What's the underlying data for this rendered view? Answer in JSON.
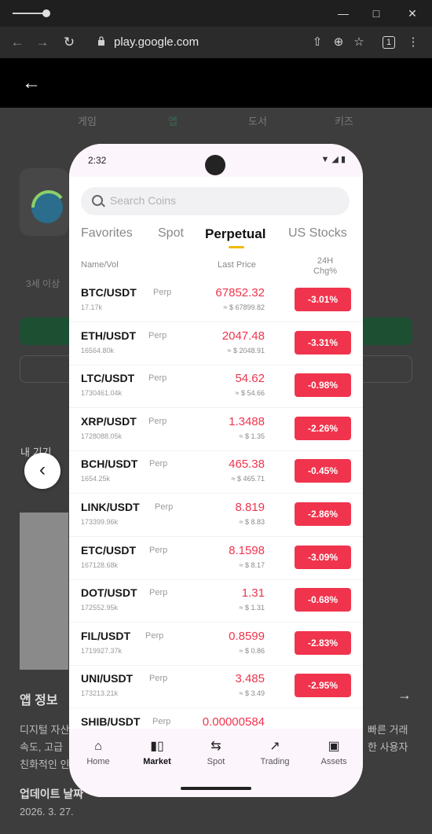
{
  "browser": {
    "url": "play.google.com",
    "tab_count": "1"
  },
  "store": {
    "categories": [
      "게임",
      "앱",
      "도서",
      "키즈"
    ],
    "age_label": "3세 이상",
    "device_label": "내 기기",
    "section_title": "앱 정보",
    "para_left": "디지털 자산",
    "para_left2": "속도, 고급 ",
    "para_left3": "친화적인 인",
    "para_right": "빠른 거래",
    "para_right2": "한 사용자",
    "update_label": "업데이트 날짜",
    "update_date": "2026. 3. 27."
  },
  "phone": {
    "time": "2:32",
    "search_placeholder": "Search Coins",
    "tabs": [
      "Favorites",
      "Spot",
      "Perpetual",
      "US Stocks"
    ],
    "headers": {
      "name": "Name/Vol",
      "price": "Last Price",
      "change": "24H Chg%"
    },
    "rows": [
      {
        "symbol": "BTC/USDT",
        "type": "Perp",
        "vol": "17.17k",
        "price": "67852.32",
        "usd": "≈ $ 67899.82",
        "change": "-3.01%"
      },
      {
        "symbol": "ETH/USDT",
        "type": "Perp",
        "vol": "16564.80k",
        "price": "2047.48",
        "usd": "≈ $ 2048.91",
        "change": "-3.31%"
      },
      {
        "symbol": "LTC/USDT",
        "type": "Perp",
        "vol": "1730461.04k",
        "price": "54.62",
        "usd": "≈ $ 54.66",
        "change": "-0.98%"
      },
      {
        "symbol": "XRP/USDT",
        "type": "Perp",
        "vol": "1728088.05k",
        "price": "1.3488",
        "usd": "≈ $ 1.35",
        "change": "-2.26%"
      },
      {
        "symbol": "BCH/USDT",
        "type": "Perp",
        "vol": "1654.25k",
        "price": "465.38",
        "usd": "≈ $ 465.71",
        "change": "-0.45%"
      },
      {
        "symbol": "LINK/USDT",
        "type": "Perp",
        "vol": "173399.96k",
        "price": "8.819",
        "usd": "≈ $ 8.83",
        "change": "-2.86%"
      },
      {
        "symbol": "ETC/USDT",
        "type": "Perp",
        "vol": "167128.68k",
        "price": "8.1598",
        "usd": "≈ $ 8.17",
        "change": "-3.09%"
      },
      {
        "symbol": "DOT/USDT",
        "type": "Perp",
        "vol": "172552.95k",
        "price": "1.31",
        "usd": "≈ $ 1.31",
        "change": "-0.68%"
      },
      {
        "symbol": "FIL/USDT",
        "type": "Perp",
        "vol": "1719927.37k",
        "price": "0.8599",
        "usd": "≈ $ 0.86",
        "change": "-2.83%"
      },
      {
        "symbol": "UNI/USDT",
        "type": "Perp",
        "vol": "173213.21k",
        "price": "3.485",
        "usd": "≈ $ 3.49",
        "change": "-2.95%"
      },
      {
        "symbol": "SHIB/USDT",
        "type": "Perp",
        "vol": "",
        "price": "0.00000584",
        "usd": "",
        "change": ""
      }
    ],
    "nav": [
      {
        "label": "Home",
        "icon": "home-icon"
      },
      {
        "label": "Market",
        "icon": "candlestick-icon"
      },
      {
        "label": "Spot",
        "icon": "exchange-icon"
      },
      {
        "label": "Trading",
        "icon": "chart-icon"
      },
      {
        "label": "Assets",
        "icon": "wallet-icon"
      }
    ]
  },
  "colors": {
    "down": "#f0344d",
    "accent": "#f0b90b",
    "store_green": "#1d4f33"
  }
}
